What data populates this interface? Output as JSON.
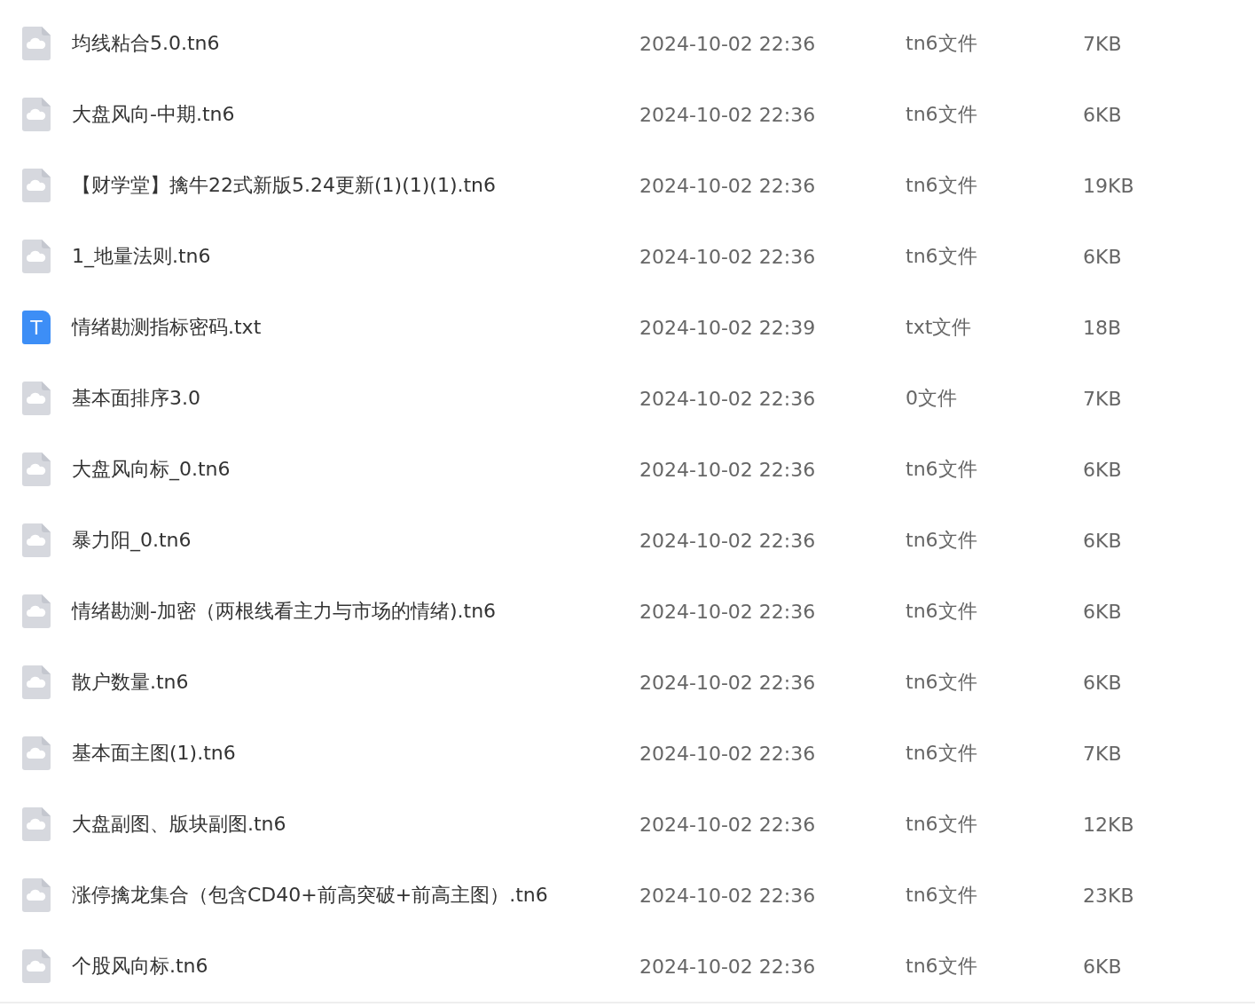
{
  "files": [
    {
      "kind": "cloud",
      "name": "均线粘合5.0.tn6",
      "modified": "2024-10-02 22:36",
      "type": "tn6文件",
      "size": "7KB"
    },
    {
      "kind": "cloud",
      "name": "大盘风向-中期.tn6",
      "modified": "2024-10-02 22:36",
      "type": "tn6文件",
      "size": "6KB"
    },
    {
      "kind": "cloud",
      "name": "【财学堂】擒牛22式新版5.24更新(1)(1)(1).tn6",
      "modified": "2024-10-02 22:36",
      "type": "tn6文件",
      "size": "19KB"
    },
    {
      "kind": "cloud",
      "name": "1_地量法则.tn6",
      "modified": "2024-10-02 22:36",
      "type": "tn6文件",
      "size": "6KB"
    },
    {
      "kind": "text",
      "icon_letter": "T",
      "name": "情绪勘测指标密码.txt",
      "modified": "2024-10-02 22:39",
      "type": "txt文件",
      "size": "18B"
    },
    {
      "kind": "cloud",
      "name": "基本面排序3.0",
      "modified": "2024-10-02 22:36",
      "type": "0文件",
      "size": "7KB"
    },
    {
      "kind": "cloud",
      "name": "大盘风向标_0.tn6",
      "modified": "2024-10-02 22:36",
      "type": "tn6文件",
      "size": "6KB"
    },
    {
      "kind": "cloud",
      "name": "暴力阳_0.tn6",
      "modified": "2024-10-02 22:36",
      "type": "tn6文件",
      "size": "6KB"
    },
    {
      "kind": "cloud",
      "name": "情绪勘测-加密（两根线看主力与市场的情绪).tn6",
      "modified": "2024-10-02 22:36",
      "type": "tn6文件",
      "size": "6KB"
    },
    {
      "kind": "cloud",
      "name": "散户数量.tn6",
      "modified": "2024-10-02 22:36",
      "type": "tn6文件",
      "size": "6KB"
    },
    {
      "kind": "cloud",
      "name": "基本面主图(1).tn6",
      "modified": "2024-10-02 22:36",
      "type": "tn6文件",
      "size": "7KB"
    },
    {
      "kind": "cloud",
      "name": "大盘副图、版块副图.tn6",
      "modified": "2024-10-02 22:36",
      "type": "tn6文件",
      "size": "12KB"
    },
    {
      "kind": "cloud",
      "name": "涨停擒龙集合（包含CD40+前高突破+前高主图）.tn6",
      "modified": "2024-10-02 22:36",
      "type": "tn6文件",
      "size": "23KB"
    },
    {
      "kind": "cloud",
      "name": "个股风向标.tn6",
      "modified": "2024-10-02 22:36",
      "type": "tn6文件",
      "size": "6KB"
    }
  ]
}
